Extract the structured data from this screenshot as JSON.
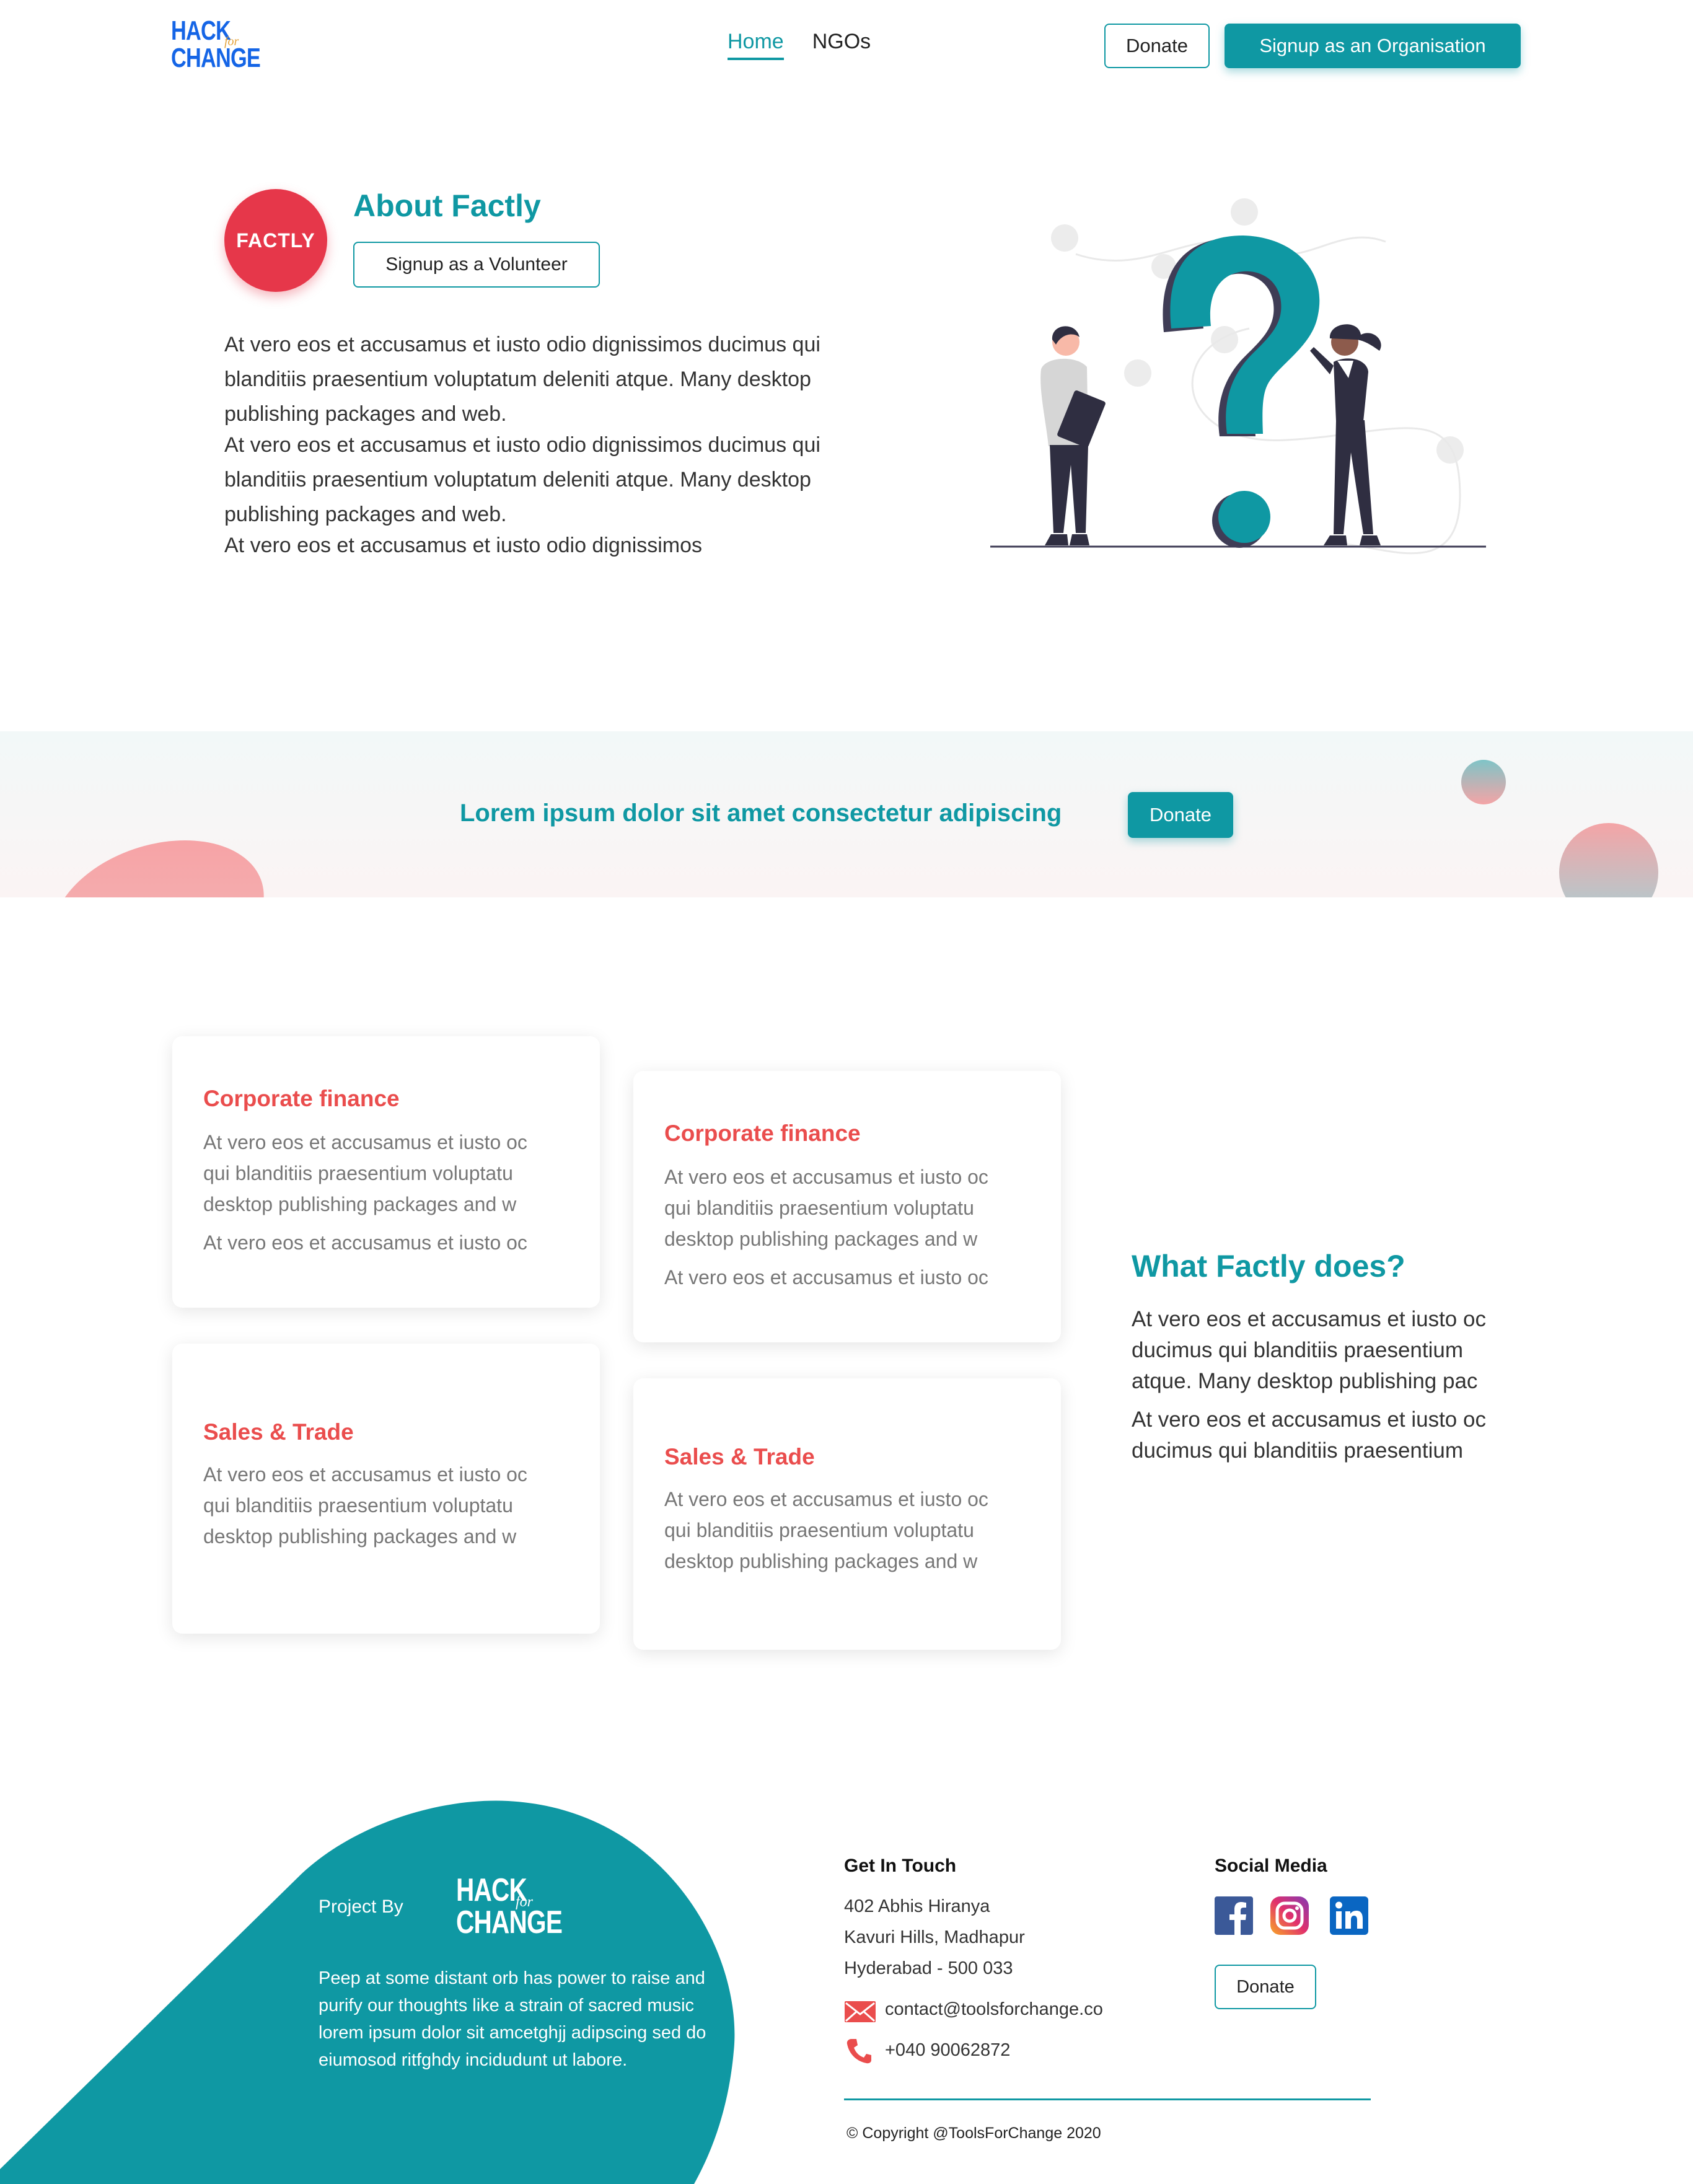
{
  "nav": {
    "logo_line1": "HACK",
    "logo_for": "for",
    "logo_line2": "CHANGE",
    "links": [
      {
        "label": "Home",
        "active": true
      },
      {
        "label": "NGOs",
        "active": false
      }
    ],
    "donate_label": "Donate",
    "signup_org_label": "Signup as an Organisation"
  },
  "about": {
    "logo_text": "FACTLY",
    "title": "About Factly",
    "volunteer_label": "Signup as a Volunteer",
    "paragraphs": [
      "At vero eos et accusamus et iusto odio dignissimos ducimus qui blanditiis praesentium voluptatum deleniti atque. Many desktop publishing packages and web.",
      "At vero eos et accusamus et iusto odio dignissimos ducimus qui blanditiis praesentium voluptatum deleniti atque. Many desktop publishing packages and web.",
      "At vero eos et accusamus et iusto odio dignissimos"
    ]
  },
  "banner": {
    "text": "Lorem ipsum dolor sit amet consectetur adipiscing",
    "donate_label": "Donate"
  },
  "cards": [
    {
      "title": "Corporate finance",
      "lines": [
        "At vero eos et accusamus et iusto oc",
        "qui blanditiis praesentium voluptatu",
        "desktop publishing packages and w"
      ],
      "extra": "At vero eos et accusamus et iusto oc"
    },
    {
      "title": "Corporate finance",
      "lines": [
        "At vero eos et accusamus et iusto oc",
        "qui blanditiis praesentium voluptatu",
        "desktop publishing packages and w"
      ],
      "extra": "At vero eos et accusamus et iusto oc"
    },
    {
      "title": "Sales & Trade",
      "lines": [
        "At vero eos et accusamus et iusto oc",
        "qui blanditiis praesentium voluptatu",
        "desktop publishing packages and w"
      ],
      "extra": ""
    },
    {
      "title": "Sales & Trade",
      "lines": [
        "At vero eos et accusamus et iusto oc",
        "qui blanditiis praesentium voluptatu",
        "desktop publishing packages and w"
      ],
      "extra": ""
    }
  ],
  "does": {
    "title": "What Factly does?",
    "lines": [
      "At vero eos et accusamus et iusto oc",
      "ducimus qui blanditiis praesentium",
      "atque. Many desktop publishing pac"
    ],
    "lines2": [
      "At vero eos et accusamus et iusto oc",
      "ducimus qui blanditiis praesentium"
    ]
  },
  "footer": {
    "project_by": "Project By",
    "about_text": "Peep at some distant orb has power to raise and purify our thoughts like a strain of sacred music lorem ipsum dolor sit amcetghjj adipscing sed do eiumosod ritfghdy incidudunt ut labore.",
    "contact_heading": "Get In Touch",
    "address": [
      "402 Abhis Hiranya",
      "Kavuri Hills, Madhapur",
      "Hyderabad - 500 033"
    ],
    "email": "contact@toolsforchange.co",
    "phone": "+040  90062872",
    "social_heading": "Social Media",
    "social": [
      "facebook-icon",
      "instagram-icon",
      "linkedin-icon"
    ],
    "donate_label": "Donate",
    "copyright": "© Copyright @ToolsForChange 2020"
  },
  "colors": {
    "primary": "#0f98a3",
    "accent": "#ea4d4d",
    "factly_red": "#e6374a",
    "logo_blue": "#1565e6"
  }
}
